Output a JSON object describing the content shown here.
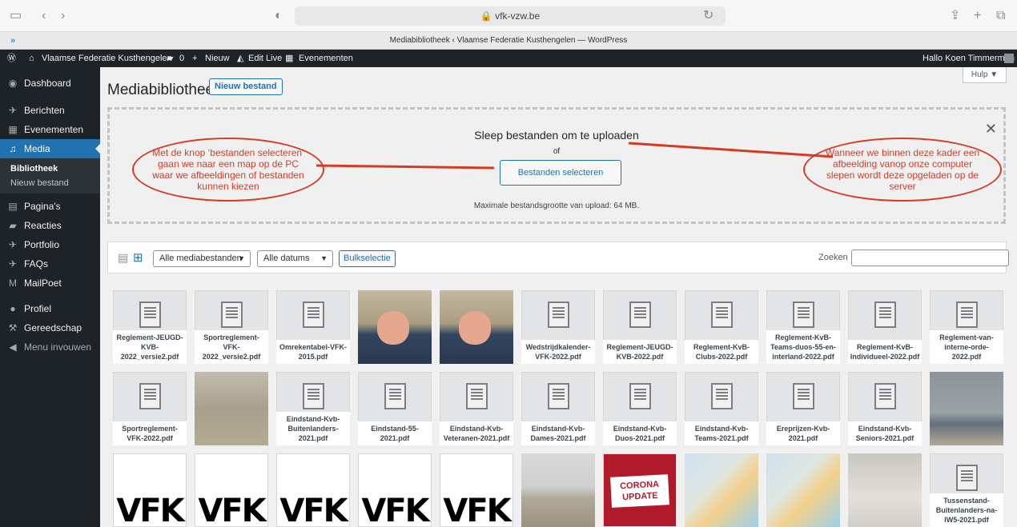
{
  "browser": {
    "url": "vfk-vzw.be",
    "tab_title": "Mediabibliotheek ‹ Vlaamse Federatie Kusthengelen — WordPress"
  },
  "adminbar": {
    "site": "Vlaamse Federatie Kusthengelen",
    "comments": "0",
    "new": "Nieuw",
    "edit_live": "Edit Live",
    "events": "Evenementen",
    "greeting": "Hallo Koen Timmerman"
  },
  "menu": {
    "dashboard": "Dashboard",
    "berichten": "Berichten",
    "evenementen": "Evenementen",
    "media": "Media",
    "bibliotheek": "Bibliotheek",
    "nieuw_bestand": "Nieuw bestand",
    "paginas": "Pagina's",
    "reacties": "Reacties",
    "portfolio": "Portfolio",
    "faqs": "FAQs",
    "mailpoet": "MailPoet",
    "profiel": "Profiel",
    "gereedschap": "Gereedschap",
    "menu_invouwen": "Menu invouwen"
  },
  "page": {
    "title": "Mediabibliotheek",
    "new_button": "Nieuw bestand",
    "help": "Hulp ▼"
  },
  "upload": {
    "title": "Sleep bestanden om te uploaden",
    "or": "of",
    "select": "Bestanden selecteren",
    "max": "Maximale bestandsgrootte van upload: 64 MB."
  },
  "annotations": {
    "left": "Met de knop ‘bestanden selecteren’ gaan we naar een map op de PC waar we afbeeldingen of bestanden kunnen kiezen",
    "right": "Wanneer we binnen deze kader een afbeelding vanop onze computer slepen wordt deze opgeladen op de server"
  },
  "toolbar": {
    "filter_type": "Alle mediabestanden",
    "filter_date": "Alle datums",
    "bulk": "Bulkselectie",
    "search_label": "Zoeken"
  },
  "media": [
    [
      "doc",
      "Reglement-JEUGD-KVB-2022_versie2.pdf"
    ],
    [
      "doc",
      "Sportreglement-VFK-2022_versie2.pdf"
    ],
    [
      "doc",
      "Omrekentabel-VFK-2015.pdf"
    ],
    [
      "photo1",
      ""
    ],
    [
      "photo1",
      ""
    ],
    [
      "doc",
      "Wedstrijdkalender-VFK-2022.pdf"
    ],
    [
      "doc",
      "Reglement-JEUGD-KVB-2022.pdf"
    ],
    [
      "doc",
      "Reglement-KvB-Clubs-2022.pdf"
    ],
    [
      "doc",
      "Reglement-KvB-Teams-duos-55-en-interland-2022.pdf"
    ],
    [
      "doc",
      "Reglement-KvB-Individueel-2022.pdf"
    ],
    [
      "doc",
      "Reglement-van-interne-orde-2022.pdf"
    ],
    [
      "doc",
      "Sportreglement-VFK-2022.pdf"
    ],
    [
      "photo2",
      ""
    ],
    [
      "doc",
      "Eindstand-Kvb-Buitenlanders-2021.pdf"
    ],
    [
      "doc",
      "Eindstand-55-2021.pdf"
    ],
    [
      "doc",
      "Eindstand-Kvb-Veteranen-2021.pdf"
    ],
    [
      "doc",
      "Eindstand-Kvb-Dames-2021.pdf"
    ],
    [
      "doc",
      "Eindstand-Kvb-Duos-2021.pdf"
    ],
    [
      "doc",
      "Eindstand-Kvb-Teams-2021.pdf"
    ],
    [
      "doc",
      "Ereprijzen-Kvb-2021.pdf"
    ],
    [
      "doc",
      "Eindstand-Kvb-Seniors-2021.pdf"
    ],
    [
      "photo3",
      ""
    ],
    [
      "logo",
      "VFK"
    ],
    [
      "logo",
      "VFK"
    ],
    [
      "logo",
      "VFK"
    ],
    [
      "logo",
      "VFK"
    ],
    [
      "logo",
      "VFK"
    ],
    [
      "photo4",
      ""
    ],
    [
      "corona",
      "CORONA UPDATE"
    ],
    [
      "map",
      ""
    ],
    [
      "map",
      ""
    ],
    [
      "pole",
      ""
    ],
    [
      "doc",
      "Tussenstand-Buitenlanders-na-IW5-2021.pdf"
    ]
  ]
}
